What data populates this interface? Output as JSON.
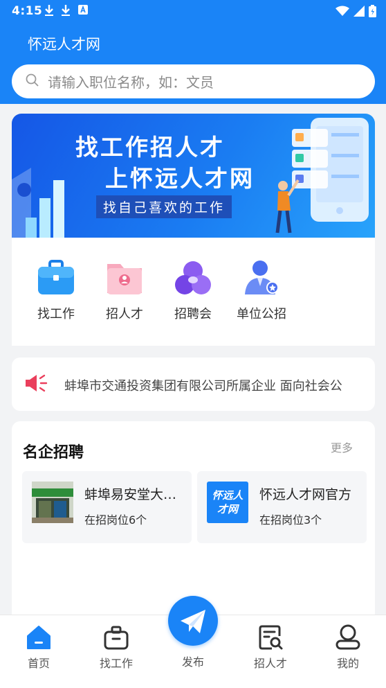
{
  "status_bar": {
    "time": "4:15"
  },
  "header": {
    "title": "怀远人才网",
    "search_placeholder": "请输入职位名称，如：文员"
  },
  "banner": {
    "line1": "找工作招人才",
    "line2": "上怀远人才网",
    "subtitle": "找自己喜欢的工作"
  },
  "quick_menu": [
    {
      "label": "找工作",
      "icon": "briefcase-icon"
    },
    {
      "label": "招人才",
      "icon": "person-folder-icon"
    },
    {
      "label": "招聘会",
      "icon": "job-fair-icon"
    },
    {
      "label": "单位公招",
      "icon": "official-user-icon"
    }
  ],
  "notice": {
    "text": "蚌埠市交通投资集团有限公司所属企业 面向社会公"
  },
  "companies": {
    "title": "名企招聘",
    "more": "更多",
    "items": [
      {
        "name": "蚌埠易安堂大…",
        "count": "在招岗位6个"
      },
      {
        "name": "怀远人才网官方",
        "count": "在招岗位3个",
        "logo_text": "怀远人才网"
      }
    ]
  },
  "bottom_nav": [
    {
      "label": "首页",
      "icon": "home-icon"
    },
    {
      "label": "找工作",
      "icon": "briefcase-icon"
    },
    {
      "label": "发布",
      "icon": "paper-plane-icon"
    },
    {
      "label": "招人才",
      "icon": "resume-search-icon"
    },
    {
      "label": "我的",
      "icon": "user-icon"
    }
  ],
  "colors": {
    "primary": "#1a84f7",
    "notice_red": "#ea3f5c"
  }
}
